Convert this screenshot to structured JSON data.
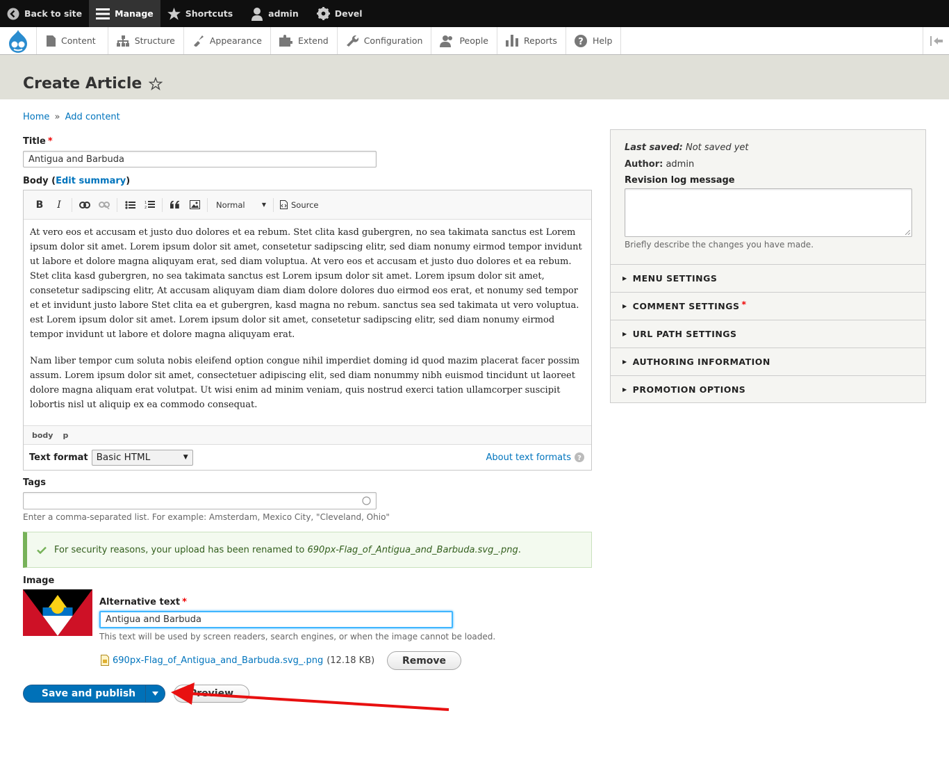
{
  "toolbar": {
    "back": "Back to site",
    "manage": "Manage",
    "shortcuts": "Shortcuts",
    "user": "admin",
    "devel": "Devel"
  },
  "tray": [
    "Content",
    "Structure",
    "Appearance",
    "Extend",
    "Configuration",
    "People",
    "Reports",
    "Help"
  ],
  "page_title": "Create Article",
  "breadcrumb": {
    "home": "Home",
    "sep": "»",
    "add": "Add content"
  },
  "title_field": {
    "label": "Title",
    "required": "*",
    "value": "Antigua and Barbuda"
  },
  "body_field": {
    "label": "Body",
    "edit_summary": "Edit summary",
    "open": "(",
    "close": ")"
  },
  "editor": {
    "buttons": {
      "bold": "B",
      "italic": "I",
      "format": "Normal",
      "source": "Source"
    },
    "paragraphs": [
      "At vero eos et accusam et justo duo dolores et ea rebum. Stet clita kasd gubergren, no sea takimata sanctus est Lorem ipsum dolor sit amet. Lorem ipsum dolor sit amet, consetetur sadipscing elitr, sed diam nonumy eirmod tempor invidunt ut labore et dolore magna aliquyam erat, sed diam voluptua. At vero eos et accusam et justo duo dolores et ea rebum. Stet clita kasd gubergren, no sea takimata sanctus est Lorem ipsum dolor sit amet. Lorem ipsum dolor sit amet, consetetur sadipscing elitr, At accusam aliquyam diam diam dolore dolores duo eirmod eos erat, et nonumy sed tempor et et invidunt justo labore Stet clita ea et gubergren, kasd magna no rebum. sanctus sea sed takimata ut vero voluptua. est Lorem ipsum dolor sit amet. Lorem ipsum dolor sit amet, consetetur sadipscing elitr, sed diam nonumy eirmod tempor invidunt ut labore et dolore magna aliquyam erat.",
      "Nam liber tempor cum soluta nobis eleifend option congue nihil imperdiet doming id quod mazim placerat facer possim assum. Lorem ipsum dolor sit amet, consectetuer adipiscing elit, sed diam nonummy nibh euismod tincidunt ut laoreet dolore magna aliquam erat volutpat. Ut wisi enim ad minim veniam, quis nostrud exerci tation ullamcorper suscipit lobortis nisl ut aliquip ex ea commodo consequat."
    ],
    "path": [
      "body",
      "p"
    ],
    "text_format_label": "Text format",
    "text_format_value": "Basic HTML",
    "about_formats": "About text formats"
  },
  "tags": {
    "label": "Tags",
    "description": "Enter a comma-separated list. For example: Amsterdam, Mexico City, \"Cleveland, Ohio\""
  },
  "message": {
    "text": "For security reasons, your upload has been renamed to",
    "filename": "690px-Flag_of_Antigua_and_Barbuda.svg_.png",
    "end": "."
  },
  "image": {
    "label": "Image",
    "alt_label": "Alternative text",
    "alt_value": "Antigua and Barbuda",
    "alt_desc": "This text will be used by screen readers, search engines, or when the image cannot be loaded.",
    "file_link": "690px-Flag_of_Antigua_and_Barbuda.svg_.png",
    "file_size": "(12.18 KB)",
    "remove": "Remove"
  },
  "actions": {
    "save": "Save and publish",
    "preview": "Preview"
  },
  "sidebar": {
    "last_saved_label": "Last saved:",
    "last_saved_value": "Not saved yet",
    "author_label": "Author:",
    "author_value": "admin",
    "revision_label": "Revision log message",
    "revision_desc": "Briefly describe the changes you have made.",
    "sections": [
      "MENU SETTINGS",
      "COMMENT SETTINGS",
      "URL PATH SETTINGS",
      "AUTHORING INFORMATION",
      "PROMOTION OPTIONS"
    ]
  },
  "colors": {
    "link": "#0074bd",
    "primary": "#0071b8",
    "annotation_arrow": "#e81010",
    "flag_red": "#ce1126",
    "flag_blue": "#0072c6",
    "flag_gold": "#fcd116"
  }
}
